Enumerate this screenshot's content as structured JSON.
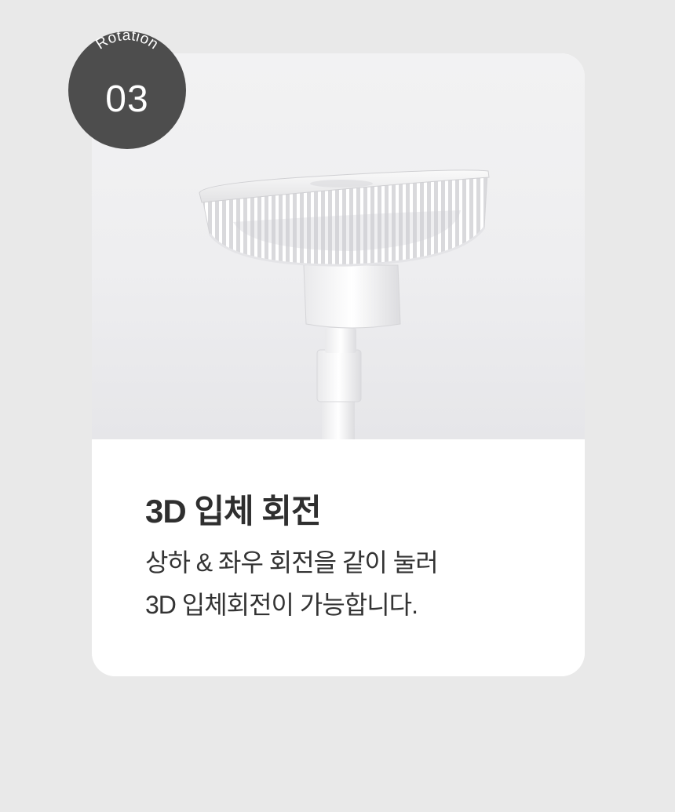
{
  "badge": {
    "label": "Rotation",
    "number": "03"
  },
  "card": {
    "title": "3D 입체 회전",
    "description_lines": [
      "상하 & 좌우 회전을 같이 눌러",
      "3D 입체회전이 가능합니다."
    ]
  },
  "colors": {
    "page_background": "#e9e9e9",
    "card_background": "#ffffff",
    "badge_background": "#4d4d4d",
    "title_text": "#2f2f2f",
    "body_text": "#333333"
  }
}
